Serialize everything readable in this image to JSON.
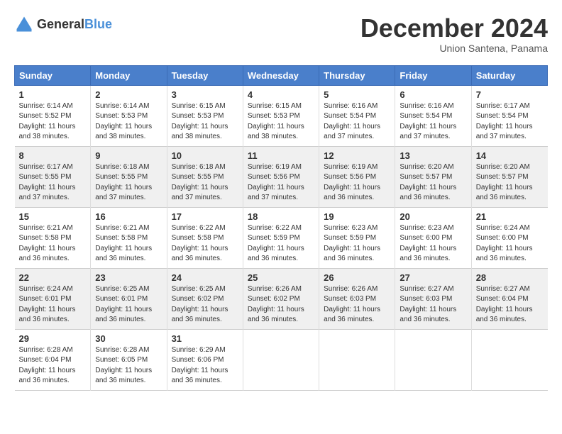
{
  "header": {
    "logo_general": "General",
    "logo_blue": "Blue",
    "month_year": "December 2024",
    "location": "Union Santena, Panama"
  },
  "calendar": {
    "days_of_week": [
      "Sunday",
      "Monday",
      "Tuesday",
      "Wednesday",
      "Thursday",
      "Friday",
      "Saturday"
    ],
    "weeks": [
      [
        {
          "day": "",
          "info": ""
        },
        {
          "day": "2",
          "info": "Sunrise: 6:14 AM\nSunset: 5:53 PM\nDaylight: 11 hours\nand 38 minutes."
        },
        {
          "day": "3",
          "info": "Sunrise: 6:15 AM\nSunset: 5:53 PM\nDaylight: 11 hours\nand 38 minutes."
        },
        {
          "day": "4",
          "info": "Sunrise: 6:15 AM\nSunset: 5:53 PM\nDaylight: 11 hours\nand 38 minutes."
        },
        {
          "day": "5",
          "info": "Sunrise: 6:16 AM\nSunset: 5:54 PM\nDaylight: 11 hours\nand 37 minutes."
        },
        {
          "day": "6",
          "info": "Sunrise: 6:16 AM\nSunset: 5:54 PM\nDaylight: 11 hours\nand 37 minutes."
        },
        {
          "day": "7",
          "info": "Sunrise: 6:17 AM\nSunset: 5:54 PM\nDaylight: 11 hours\nand 37 minutes."
        }
      ],
      [
        {
          "day": "8",
          "info": "Sunrise: 6:17 AM\nSunset: 5:55 PM\nDaylight: 11 hours\nand 37 minutes."
        },
        {
          "day": "9",
          "info": "Sunrise: 6:18 AM\nSunset: 5:55 PM\nDaylight: 11 hours\nand 37 minutes."
        },
        {
          "day": "10",
          "info": "Sunrise: 6:18 AM\nSunset: 5:55 PM\nDaylight: 11 hours\nand 37 minutes."
        },
        {
          "day": "11",
          "info": "Sunrise: 6:19 AM\nSunset: 5:56 PM\nDaylight: 11 hours\nand 37 minutes."
        },
        {
          "day": "12",
          "info": "Sunrise: 6:19 AM\nSunset: 5:56 PM\nDaylight: 11 hours\nand 36 minutes."
        },
        {
          "day": "13",
          "info": "Sunrise: 6:20 AM\nSunset: 5:57 PM\nDaylight: 11 hours\nand 36 minutes."
        },
        {
          "day": "14",
          "info": "Sunrise: 6:20 AM\nSunset: 5:57 PM\nDaylight: 11 hours\nand 36 minutes."
        }
      ],
      [
        {
          "day": "15",
          "info": "Sunrise: 6:21 AM\nSunset: 5:58 PM\nDaylight: 11 hours\nand 36 minutes."
        },
        {
          "day": "16",
          "info": "Sunrise: 6:21 AM\nSunset: 5:58 PM\nDaylight: 11 hours\nand 36 minutes."
        },
        {
          "day": "17",
          "info": "Sunrise: 6:22 AM\nSunset: 5:58 PM\nDaylight: 11 hours\nand 36 minutes."
        },
        {
          "day": "18",
          "info": "Sunrise: 6:22 AM\nSunset: 5:59 PM\nDaylight: 11 hours\nand 36 minutes."
        },
        {
          "day": "19",
          "info": "Sunrise: 6:23 AM\nSunset: 5:59 PM\nDaylight: 11 hours\nand 36 minutes."
        },
        {
          "day": "20",
          "info": "Sunrise: 6:23 AM\nSunset: 6:00 PM\nDaylight: 11 hours\nand 36 minutes."
        },
        {
          "day": "21",
          "info": "Sunrise: 6:24 AM\nSunset: 6:00 PM\nDaylight: 11 hours\nand 36 minutes."
        }
      ],
      [
        {
          "day": "22",
          "info": "Sunrise: 6:24 AM\nSunset: 6:01 PM\nDaylight: 11 hours\nand 36 minutes."
        },
        {
          "day": "23",
          "info": "Sunrise: 6:25 AM\nSunset: 6:01 PM\nDaylight: 11 hours\nand 36 minutes."
        },
        {
          "day": "24",
          "info": "Sunrise: 6:25 AM\nSunset: 6:02 PM\nDaylight: 11 hours\nand 36 minutes."
        },
        {
          "day": "25",
          "info": "Sunrise: 6:26 AM\nSunset: 6:02 PM\nDaylight: 11 hours\nand 36 minutes."
        },
        {
          "day": "26",
          "info": "Sunrise: 6:26 AM\nSunset: 6:03 PM\nDaylight: 11 hours\nand 36 minutes."
        },
        {
          "day": "27",
          "info": "Sunrise: 6:27 AM\nSunset: 6:03 PM\nDaylight: 11 hours\nand 36 minutes."
        },
        {
          "day": "28",
          "info": "Sunrise: 6:27 AM\nSunset: 6:04 PM\nDaylight: 11 hours\nand 36 minutes."
        }
      ],
      [
        {
          "day": "29",
          "info": "Sunrise: 6:28 AM\nSunset: 6:04 PM\nDaylight: 11 hours\nand 36 minutes."
        },
        {
          "day": "30",
          "info": "Sunrise: 6:28 AM\nSunset: 6:05 PM\nDaylight: 11 hours\nand 36 minutes."
        },
        {
          "day": "31",
          "info": "Sunrise: 6:29 AM\nSunset: 6:06 PM\nDaylight: 11 hours\nand 36 minutes."
        },
        {
          "day": "",
          "info": ""
        },
        {
          "day": "",
          "info": ""
        },
        {
          "day": "",
          "info": ""
        },
        {
          "day": "",
          "info": ""
        }
      ]
    ],
    "week1_day1": {
      "day": "1",
      "info": "Sunrise: 6:14 AM\nSunset: 5:52 PM\nDaylight: 11 hours\nand 38 minutes."
    }
  }
}
